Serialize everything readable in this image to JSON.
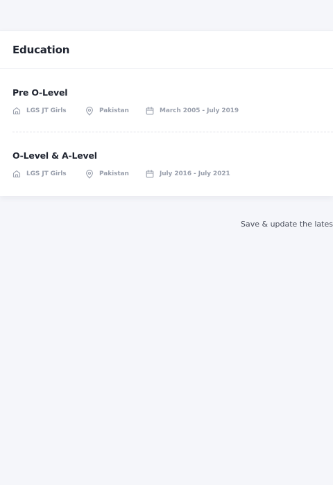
{
  "education": {
    "title": "Education",
    "entries": [
      {
        "title": "Pre O-Level",
        "school": "LGS JT Girls",
        "country": "Pakistan",
        "dates": "March 2005 - July 2019"
      },
      {
        "title": "O-Level & A-Level",
        "school": "LGS JT Girls",
        "country": "Pakistan",
        "dates": "July 2016 - July 2021"
      }
    ]
  },
  "footer": {
    "note": "Save & update the lates"
  },
  "icons": {
    "school": "home-icon",
    "location": "map-pin-icon",
    "date": "calendar-icon"
  },
  "colors": {
    "page_background": "#f5f6fa",
    "card_background": "#ffffff",
    "heading_text": "#1f2430",
    "meta_text": "#9aa0ad"
  }
}
